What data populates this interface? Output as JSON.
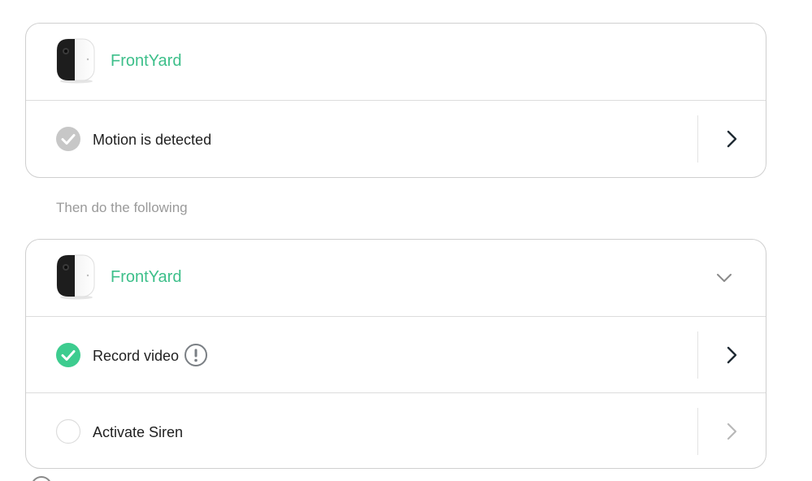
{
  "trigger": {
    "device": {
      "name": "FrontYard",
      "icon": "security-camera-thumbnail"
    },
    "condition": {
      "label": "Motion is detected",
      "checked": true,
      "check_color": "#c7c7c7"
    }
  },
  "section_heading": "Then do the following",
  "actions_card": {
    "device": {
      "name": "FrontYard",
      "icon": "security-camera-thumbnail"
    },
    "actions": [
      {
        "label": "Record video",
        "checked": true,
        "check_color": "#3dcc8f",
        "warning": true
      },
      {
        "label": "Activate Siren",
        "checked": false,
        "warning": false
      }
    ]
  },
  "colors": {
    "accent": "#3dbf8a",
    "checked": "#3dcc8f",
    "muted_text": "#9a9a9a",
    "border": "#cfcfcf"
  }
}
